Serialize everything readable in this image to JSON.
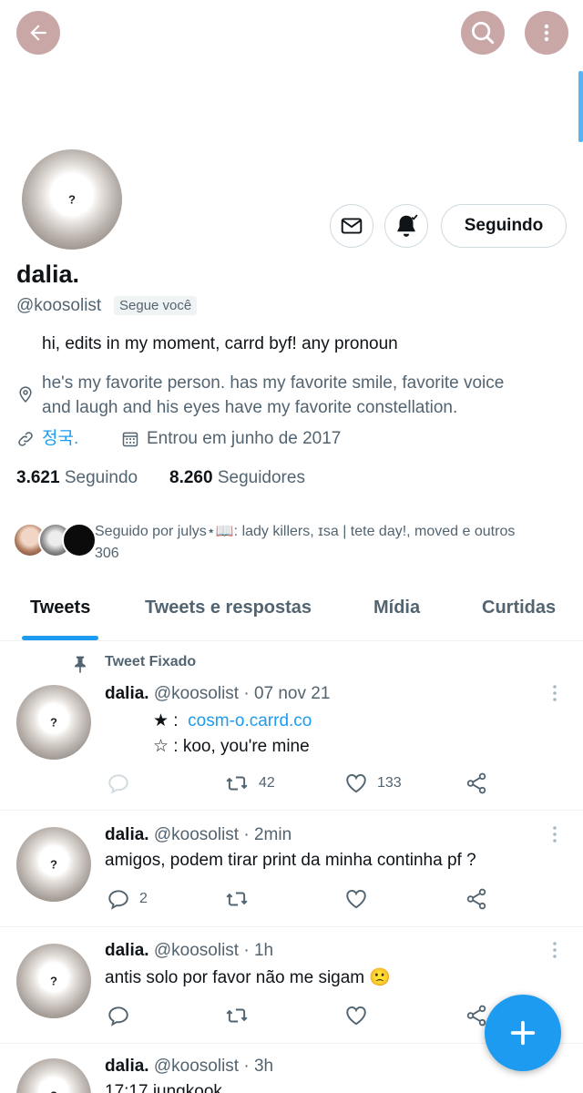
{
  "profile": {
    "name": "dalia.",
    "handle": "@koosolist",
    "follows_you": "Segue você",
    "bio": "hi, edits in my moment, carrd byf! any pronoun",
    "location": "he's my favorite person. has my favorite smile, favorite voice and laugh and his eyes have my favorite constellation.",
    "location_line1": "he's my favorite person. has my favorite smile, favorite voice",
    "location_line2": "and laugh and his eyes have my favorite constellation.",
    "website": "정국.",
    "joined": "Entrou em junho de 2017",
    "following_count": "3.621",
    "following_label": "Seguindo",
    "followers_count": "8.260",
    "followers_label": "Seguidores",
    "followed_by_line1": "Seguido por julys⋆📖: lady killers, ɪsa | tete day!, moved e outros",
    "followed_by_line2": "306",
    "follow_button": "Seguindo",
    "avatar_placeholder": "?"
  },
  "tabs": [
    {
      "label": "Tweets",
      "active": true
    },
    {
      "label": "Tweets e respostas",
      "active": false
    },
    {
      "label": "Mídia",
      "active": false
    },
    {
      "label": "Curtidas",
      "active": false
    }
  ],
  "pinned_label": "Tweet Fixado",
  "tweets": [
    {
      "name": "dalia.",
      "handle": "@koosolist · 07 nov 21",
      "line1_prefix": "★ :",
      "line1_link": "cosm-o.carrd.co",
      "line2": "☆ :  koo, you're mine",
      "replies": "",
      "retweets": "42",
      "likes": "133"
    },
    {
      "name": "dalia.",
      "handle": "@koosolist · 2min",
      "text": "amigos, podem tirar print da minha continha pf ?",
      "replies": "2",
      "retweets": "",
      "likes": ""
    },
    {
      "name": "dalia.",
      "handle": "@koosolist · 1h",
      "text": "antis solo por favor não me sigam 🙁",
      "replies": "",
      "retweets": "",
      "likes": ""
    },
    {
      "name": "dalia.",
      "handle": "@koosolist · 3h",
      "text": "17:17 jungkook"
    }
  ],
  "icons": {
    "back": "arrow-left-icon",
    "search": "search-icon",
    "more": "more-vertical-icon",
    "message": "envelope-icon",
    "notify": "bell-check-icon",
    "location": "location-pin-icon",
    "link": "link-icon",
    "calendar": "calendar-icon",
    "compose": "plus-icon"
  },
  "colors": {
    "accent": "#1d9bf0",
    "header_buttons": "#c9a7a7",
    "muted_text": "#536471"
  }
}
